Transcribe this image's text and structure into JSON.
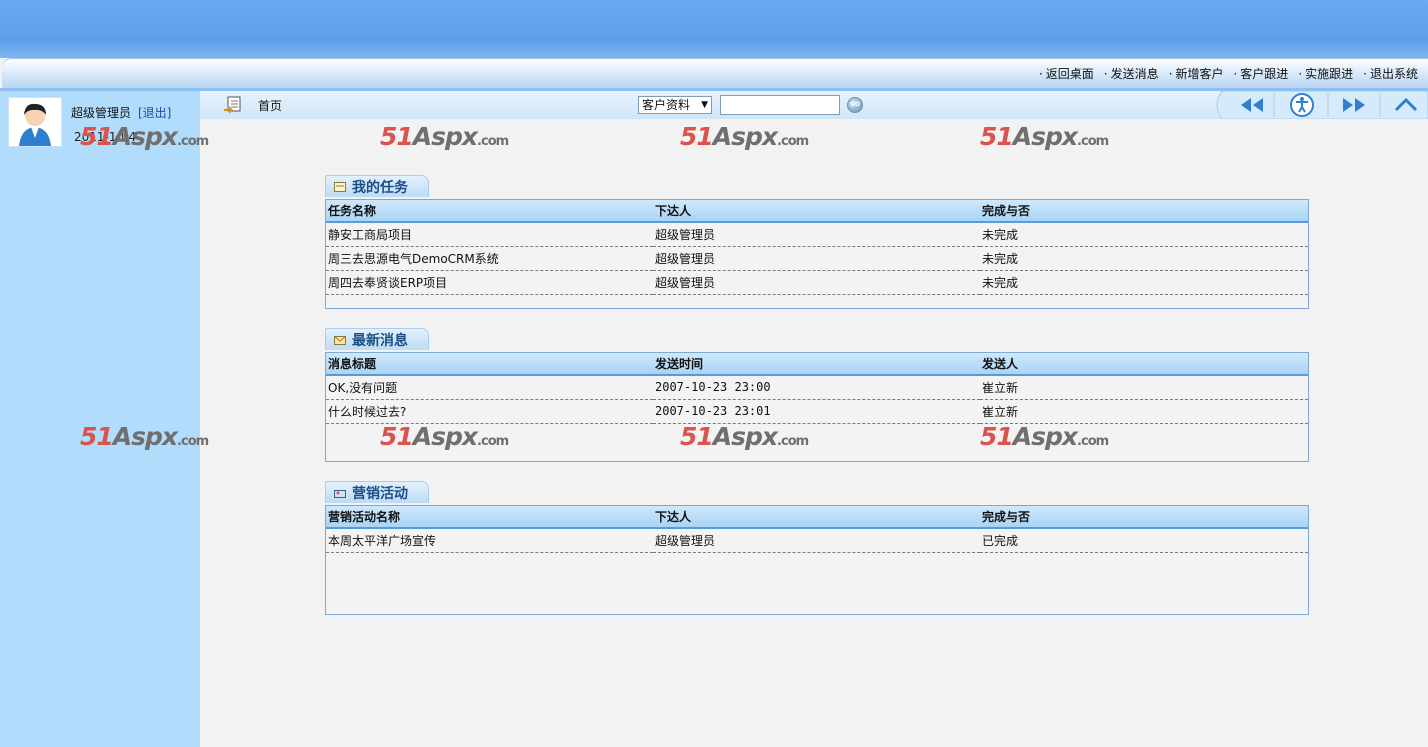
{
  "topnav": {
    "links": [
      "返回桌面",
      "发送消息",
      "新增客户",
      "客户跟进",
      "实施跟进",
      "退出系统"
    ]
  },
  "user": {
    "name": "超级管理员",
    "logout": "[退出]",
    "date": "2011-10-4"
  },
  "toolbar": {
    "home_label": "首页",
    "search_select": "客户资料",
    "search_value": "",
    "go_label": "GO"
  },
  "watermark": {
    "num": "51",
    "text": "Aspx",
    "suffix": ".com"
  },
  "tasks": {
    "title": "我的任务",
    "columns": [
      "任务名称",
      "下达人",
      "完成与否"
    ],
    "rows": [
      [
        "静安工商局项目",
        "超级管理员",
        "未完成"
      ],
      [
        "周三去思源电气DemoCRM系统",
        "超级管理员",
        "未完成"
      ],
      [
        "周四去奉贤谈ERP项目",
        "超级管理员",
        "未完成"
      ]
    ]
  },
  "messages": {
    "title": "最新消息",
    "columns": [
      "消息标题",
      "发送时间",
      "发送人"
    ],
    "rows": [
      [
        "OK,没有问题",
        "2007-10-23 23:00",
        "崔立新"
      ],
      [
        "什么时候过去?",
        "2007-10-23 23:01",
        "崔立新"
      ]
    ]
  },
  "campaigns": {
    "title": "营销活动",
    "columns": [
      "营销活动名称",
      "下达人",
      "完成与否"
    ],
    "rows": [
      [
        "本周太平洋广场宣传",
        "超级管理员",
        "已完成"
      ]
    ]
  },
  "colors": {
    "header_blue": "#5b9ee8",
    "sidebar_blue": "#b1dcfb",
    "panel_border": "#7fa9d4",
    "watermark_red": "#d9534f"
  }
}
